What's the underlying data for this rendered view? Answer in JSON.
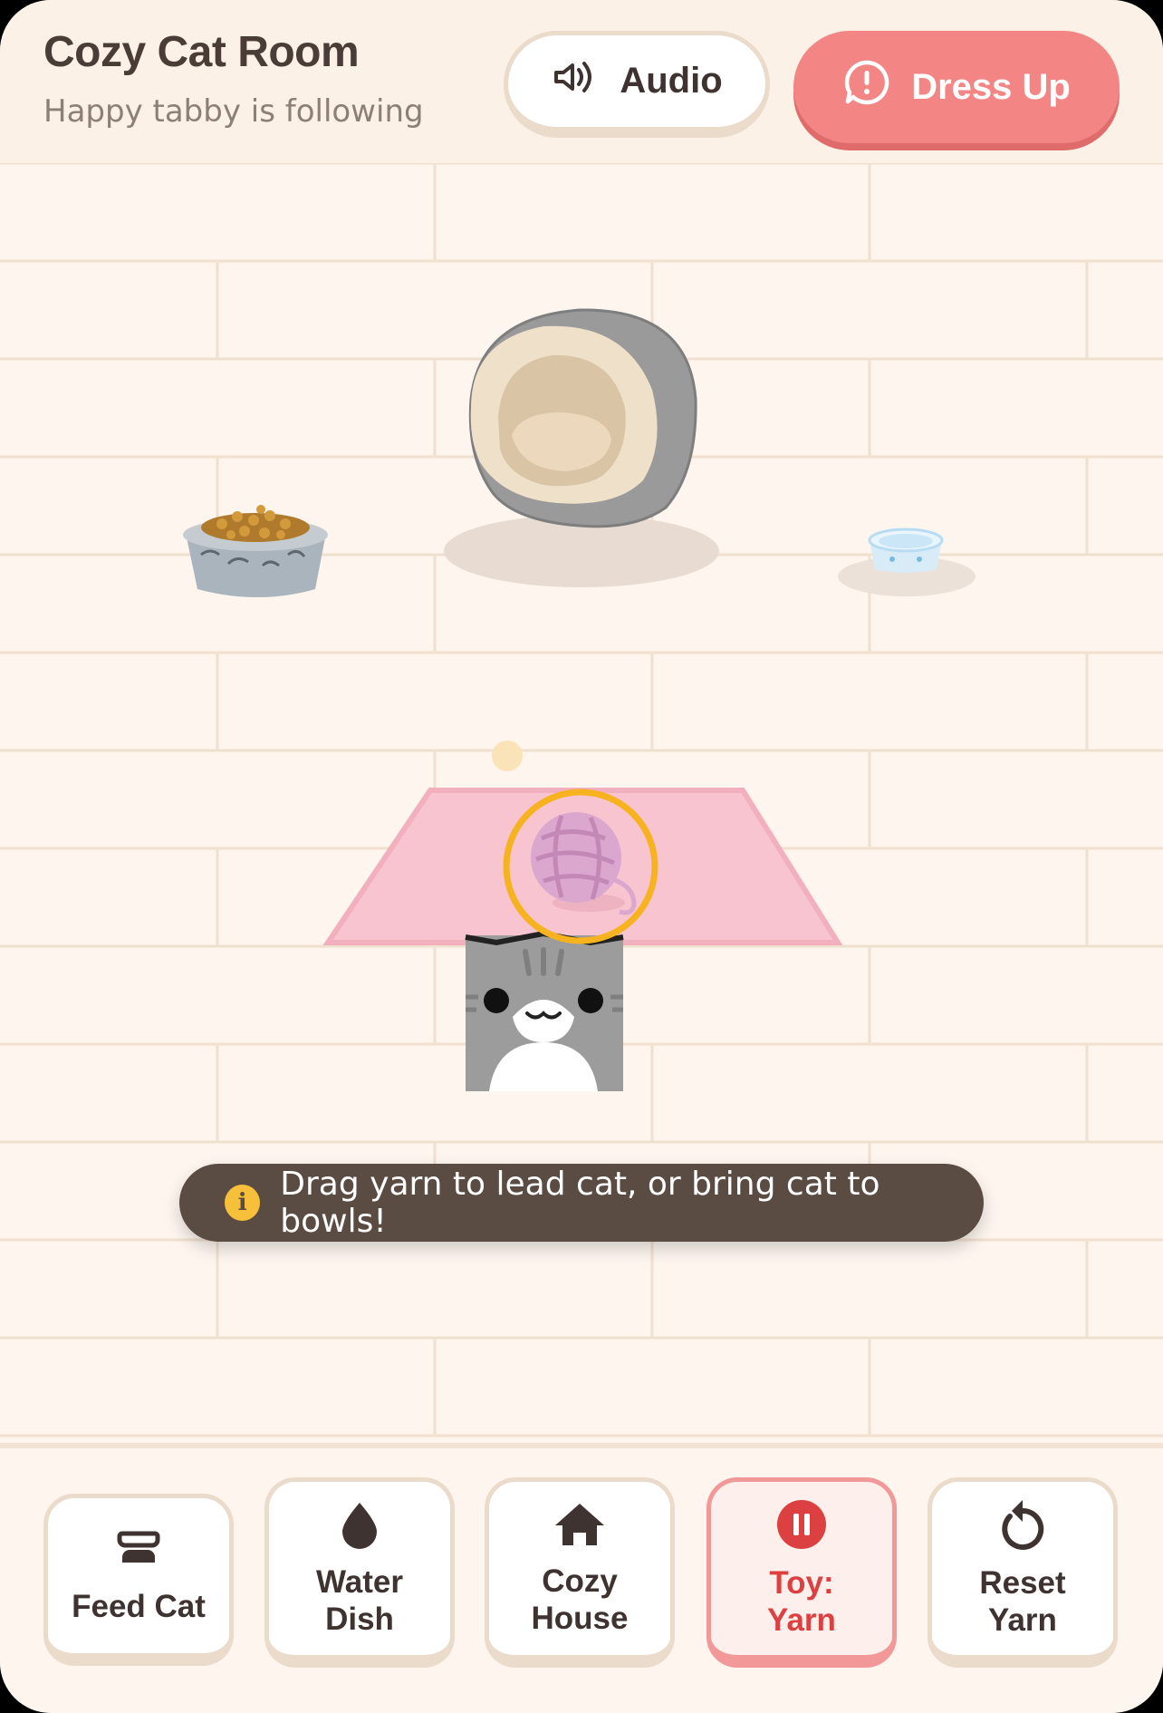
{
  "header": {
    "title": "Cozy Cat Room",
    "subtitle": "Happy tabby is following",
    "audio_label": "Audio",
    "dress_up_label": "Dress Up"
  },
  "room": {
    "items": [
      "cat-bed",
      "food-bowl",
      "water-bowl",
      "pink-rug",
      "yarn-ball",
      "cat"
    ],
    "hint": "Drag yarn to lead cat, or bring cat to bowls!"
  },
  "toolbar": {
    "items": [
      {
        "label": "Feed Cat",
        "icon": "food-bowl-icon"
      },
      {
        "label": "Water\nDish",
        "icon": "water-drop-icon"
      },
      {
        "label": "Cozy\nHouse",
        "icon": "house-icon"
      },
      {
        "label": "Toy:\nYarn",
        "icon": "pause-icon",
        "active": true
      },
      {
        "label": "Reset\nYarn",
        "icon": "reset-icon"
      }
    ]
  },
  "colors": {
    "background": "#fdf5ee",
    "accent": "#f38585",
    "active_text": "#dc4040",
    "toast": "#5b4c43",
    "yarn_ring": "#f7b21f"
  }
}
